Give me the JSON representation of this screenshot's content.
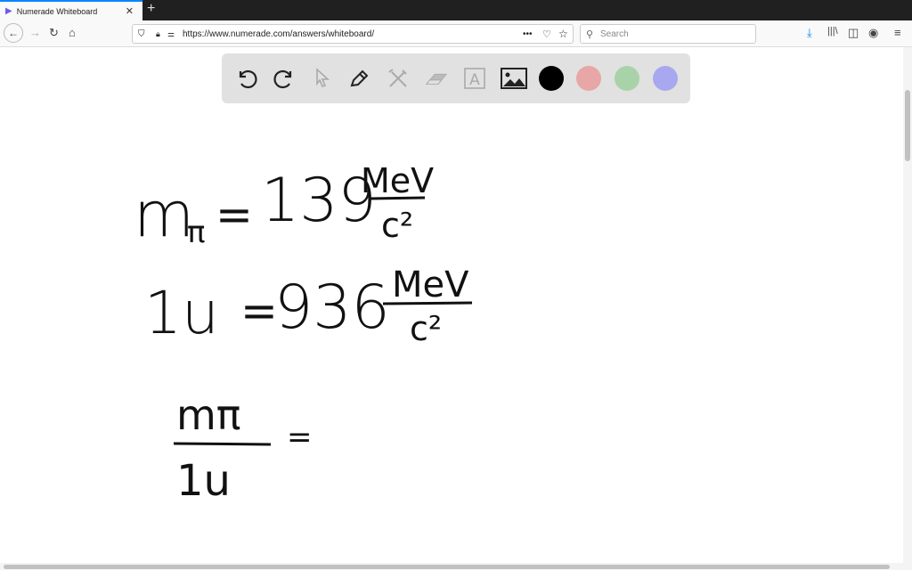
{
  "browser": {
    "tab_title": "Numerade Whiteboard",
    "url": "https://www.numerade.com/answers/whiteboard/",
    "search_placeholder": "Search"
  },
  "toolbar": {
    "tools": [
      "undo-icon",
      "redo-icon",
      "pointer-icon",
      "pen-icon",
      "tools-icon",
      "eraser-icon",
      "text-icon",
      "image-icon"
    ],
    "colors": [
      "#000000",
      "#e8a6a6",
      "#a8d3a8",
      "#a8a8f0"
    ],
    "selected_color": "#000000"
  },
  "whiteboard": {
    "line1": {
      "lhs": "m",
      "sub": "π",
      "eq": "=",
      "value": "139",
      "unit_num": "MeV",
      "unit_den": "c²"
    },
    "line2": {
      "lhs": "1u",
      "eq": "=",
      "value": "936",
      "unit_num": "MeV",
      "unit_den": "c²"
    },
    "line3": {
      "num": "mπ",
      "den": "1u",
      "eq": "="
    }
  }
}
